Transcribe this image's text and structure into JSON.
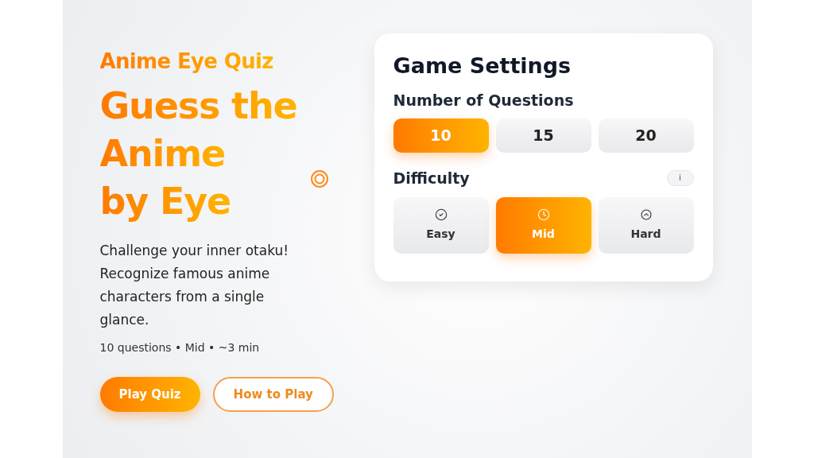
{
  "hero": {
    "eyebrow": "Anime Eye Quiz",
    "headline": [
      "Guess the",
      "Anime",
      "by Eye"
    ],
    "description": "Challenge your inner otaku! Recognize famous anime characters from a single glance.",
    "meta": "10 questions • Mid • ~3 min",
    "buttons": [
      {
        "label": "Play Quiz",
        "kind": "primary"
      },
      {
        "label": "How to Play",
        "kind": "outline"
      }
    ]
  },
  "settings": {
    "title": "Game Settings",
    "questions_label": "Number of Questions",
    "question_options": [
      {
        "label": "10",
        "selected": true
      },
      {
        "label": "15",
        "selected": false
      },
      {
        "label": "20",
        "selected": false
      }
    ],
    "difficulty_label": "Difficulty",
    "info": "i",
    "difficulty_options": [
      {
        "label": "Easy",
        "kind": "check",
        "selected": false
      },
      {
        "label": "Mid",
        "kind": "clock",
        "selected": true
      },
      {
        "label": "Hard",
        "kind": "shield",
        "selected": false
      }
    ]
  }
}
